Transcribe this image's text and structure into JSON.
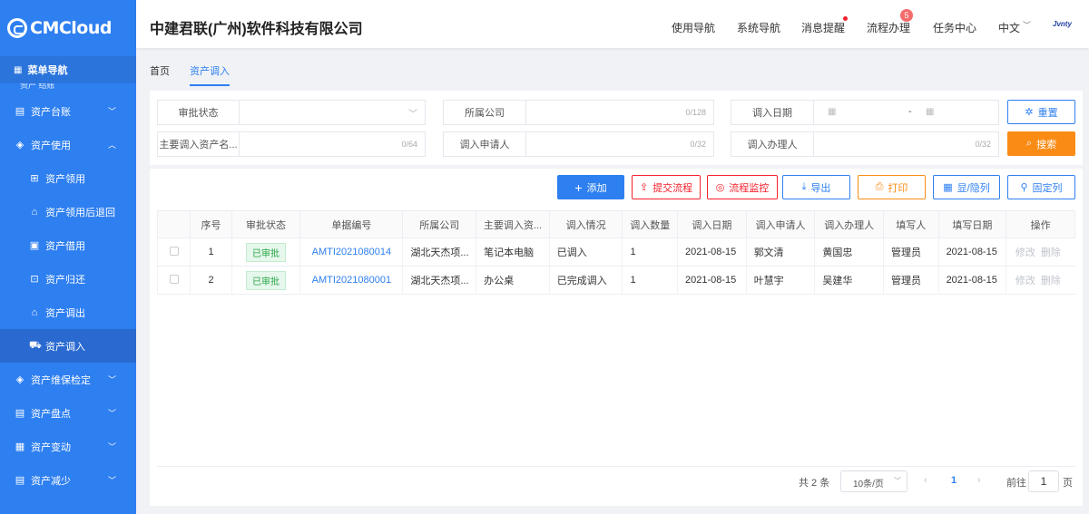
{
  "brand": {
    "logo_text": "CMCloud"
  },
  "sidebar": {
    "menu_head": "菜单导航",
    "cut_text": "资产 结账",
    "items": [
      {
        "label": "资产台账",
        "icon": "ledger-icon",
        "chev": "﹀"
      },
      {
        "label": "资产使用",
        "icon": "layers-icon",
        "chev": "︿"
      },
      {
        "label": "资产领用",
        "icon": "receive-icon"
      },
      {
        "label": "资产领用后退回",
        "icon": "return-icon"
      },
      {
        "label": "资产借用",
        "icon": "borrow-icon"
      },
      {
        "label": "资产归还",
        "icon": "giveback-icon"
      },
      {
        "label": "资产调出",
        "icon": "transfer-out-icon"
      },
      {
        "label": "资产调入",
        "icon": "transfer-in-icon"
      },
      {
        "label": "资产维保检定",
        "icon": "maintenance-icon",
        "chev": "﹀"
      },
      {
        "label": "资产盘点",
        "icon": "inventory-icon",
        "chev": "﹀"
      },
      {
        "label": "资产变动",
        "icon": "change-icon",
        "chev": "﹀"
      },
      {
        "label": "资产减少",
        "icon": "reduce-icon",
        "chev": "﹀"
      }
    ]
  },
  "header": {
    "company": "中建君联(广州)软件科技有限公司",
    "nav": [
      "使用导航",
      "系统导航",
      "消息提醒",
      "流程办理",
      "任务中心",
      "中文"
    ],
    "workflow_badge": "5",
    "lang_chev": "﹀",
    "user_mark": "Jvnty"
  },
  "tabs": [
    "首页",
    "资产调入"
  ],
  "filters": {
    "status_label": "审批状态",
    "company_label": "所属公司",
    "company_count": "0/128",
    "date_label": "调入日期",
    "date_sep": "-",
    "asset_label": "主要调入资产名...",
    "asset_count": "0/64",
    "applicant_label": "调入申请人",
    "applicant_count": "0/32",
    "handler_label": "调入办理人",
    "handler_count": "0/32",
    "reset": "重置",
    "search": "搜索"
  },
  "toolbar": [
    "添加",
    "提交流程",
    "流程监控",
    "导出",
    "打印",
    "显/隐列",
    "固定列"
  ],
  "table": {
    "headers": [
      "",
      "序号",
      "审批状态",
      "单据编号",
      "所属公司",
      "主要调入资...",
      "调入情况",
      "调入数量",
      "调入日期",
      "调入申请人",
      "调入办理人",
      "填写人",
      "填写日期",
      "操作"
    ],
    "rows": [
      {
        "no": "1",
        "status": "已审批",
        "code": "AMTI2021080014",
        "company": "湖北天杰项...",
        "asset": "笔记本电脑",
        "situation": "已调入",
        "qty": "1",
        "date": "2021-08-15",
        "applicant": "郭文清",
        "handler": "黄国忠",
        "writer": "管理员",
        "wdate": "2021-08-15",
        "edit": "修改",
        "del": "删除"
      },
      {
        "no": "2",
        "status": "已审批",
        "code": "AMTI2021080001",
        "company": "湖北天杰项...",
        "asset": "办公桌",
        "situation": "已完成调入",
        "qty": "1",
        "date": "2021-08-15",
        "applicant": "叶慧宇",
        "handler": "吴建华",
        "writer": "管理员",
        "wdate": "2021-08-15",
        "edit": "修改",
        "del": "删除"
      }
    ]
  },
  "pagination": {
    "total": "共 2 条",
    "page_size": "10条/页",
    "current": "1",
    "goto": "前往",
    "goto_value": "1",
    "page_suffix": "页"
  },
  "colors": {
    "primary": "#2e7ff0",
    "danger": "#f5222d",
    "orange": "#fa8c16",
    "success": "#28a745"
  }
}
